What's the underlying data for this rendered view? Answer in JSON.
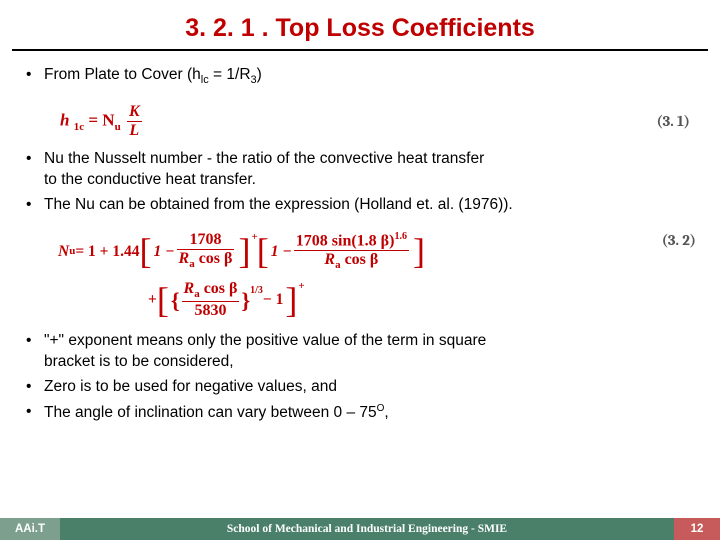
{
  "title": "3. 2. 1 . Top Loss Coefficients",
  "bullets1": {
    "b1a": "From Plate to Cover (h",
    "b1b": " = 1/R",
    "b1c": ")"
  },
  "eq1": {
    "lhs": "h ",
    "sub1": "1c",
    "eq": " = N",
    "subu": "u",
    "sp": " ",
    "frac_n": "K",
    "frac_d": "L",
    "num": "(3. 1)"
  },
  "bullets2": {
    "b2": "Nu the Nusselt number - the ratio of the convective heat transfer",
    "b2cont": "to the conductive heat transfer.",
    "b3": "The Nu can be obtained from the expression (Holland et. al. (1976))."
  },
  "eq2": {
    "pre": "N",
    "presub": "u",
    "eq": " = 1 + 1.44",
    "f1n": "1708",
    "f1d1": "R",
    "f1d1s": "a",
    "f1d2": " cos β",
    "f2n1": "1708  sin(1.8 β)",
    "f2n_exp": "1.6",
    "f2d1": "R",
    "f2d1s": "a",
    "f2d2": " cos β",
    "plus2": "+ ",
    "f3n1": "R",
    "f3n1s": "a",
    "f3n2": " cos β",
    "f3d": "5830",
    "f3exp": "1/3",
    "tail": " − 1",
    "num": "(3. 2)"
  },
  "bullets3": {
    "b4a": "\"+\" exponent means only the positive value of the term in square",
    "b4b": "bracket is to be considered,",
    "b5": " Zero is to be used for negative values, and",
    "b6a": " The angle of inclination can vary between 0 – 75",
    "b6b": ","
  },
  "footer": {
    "left": "AAi.T",
    "mid": "School of Mechanical and Industrial Engineering - SMIE",
    "right": "12"
  }
}
